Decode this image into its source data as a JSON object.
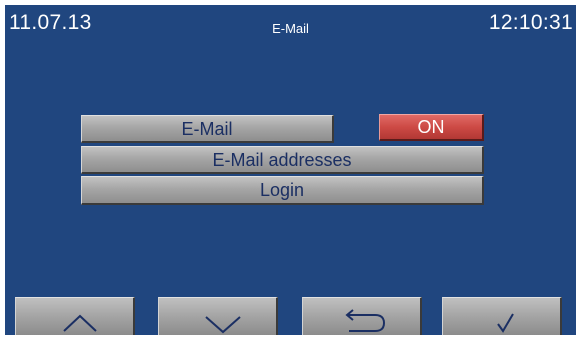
{
  "status_bar": {
    "date": "11.07.13",
    "title": "E-Mail",
    "time": "12:10:31"
  },
  "menu": {
    "items": [
      {
        "label": "E-Mail"
      },
      {
        "label": "E-Mail addresses"
      },
      {
        "label": "Login"
      }
    ],
    "email_toggle": {
      "label": "ON",
      "color": "#cd4a45"
    }
  },
  "nav_bar": {
    "buttons": [
      {
        "icon": "chevron-up-icon"
      },
      {
        "icon": "chevron-down-icon"
      },
      {
        "icon": "return-arrow-icon"
      },
      {
        "icon": "checkmark-icon"
      }
    ]
  },
  "colors": {
    "background": "#20467f",
    "button_gray": "#a6a6a6",
    "button_text": "#1b2f63",
    "toggle_on": "#cd4a45"
  }
}
